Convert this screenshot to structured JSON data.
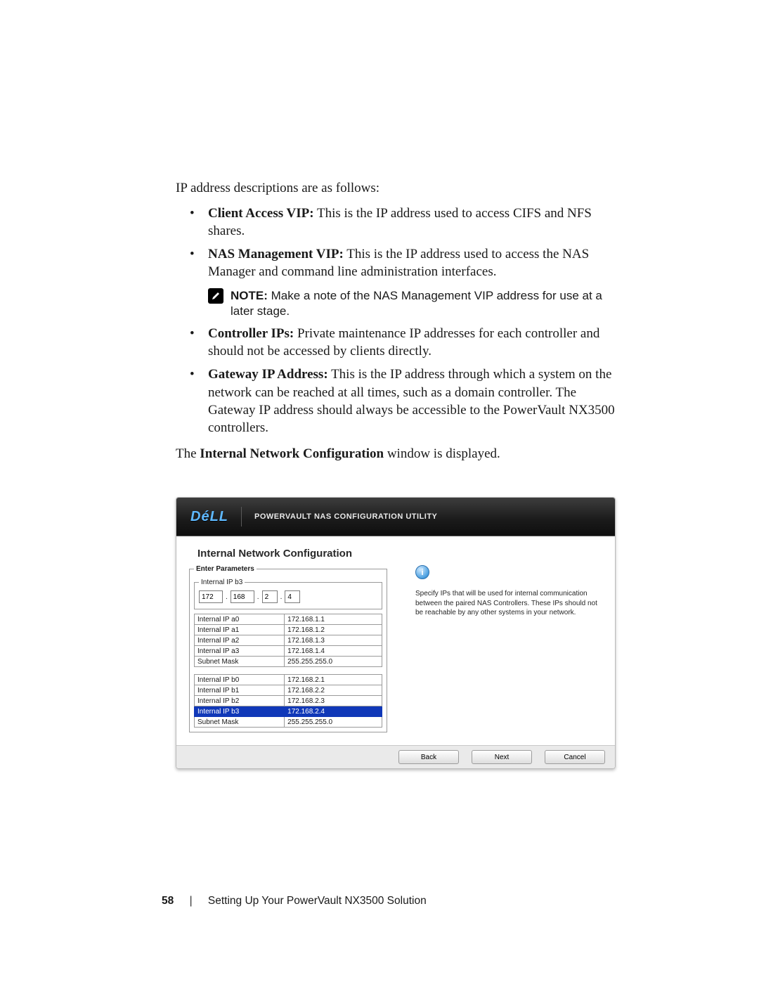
{
  "intro": "IP address descriptions are as follows:",
  "bullets_top": [
    {
      "bold": "Client Access VIP:",
      "text": " This is the IP address used to access CIFS and NFS shares."
    },
    {
      "bold": "NAS Management VIP:",
      "text": " This is the IP address used to access the NAS Manager and command line administration interfaces."
    }
  ],
  "note": {
    "bold": "NOTE:",
    "text": " Make a note of the NAS Management VIP address for use at a later stage."
  },
  "bullets_bottom": [
    {
      "bold": "Controller IPs:",
      "text": " Private maintenance IP addresses for each controller and should not be accessed by clients directly."
    },
    {
      "bold": "Gateway IP Address:",
      "text": " This is the IP address through which a system on the network can be reached at all times, such as a domain controller. The Gateway IP address should always be accessible to the PowerVault NX3500 controllers."
    }
  ],
  "displayed_prefix": "The ",
  "displayed_bold": "Internal Network Configuration",
  "displayed_suffix": " window is displayed.",
  "util": {
    "logo": "DéLL",
    "title": "POWERVAULT NAS CONFIGURATION UTILITY",
    "section": "Internal Network Configuration",
    "legend_enter": "Enter Parameters",
    "legend_b3": "Internal IP b3",
    "octets": [
      "172",
      "168",
      "2",
      "4"
    ],
    "table_a": [
      [
        "Internal IP a0",
        "172.168.1.1"
      ],
      [
        "Internal IP a1",
        "172.168.1.2"
      ],
      [
        "Internal IP a2",
        "172.168.1.3"
      ],
      [
        "Internal IP a3",
        "172.168.1.4"
      ],
      [
        "Subnet Mask",
        "255.255.255.0"
      ]
    ],
    "table_b": [
      [
        "Internal IP b0",
        "172.168.2.1"
      ],
      [
        "Internal IP b1",
        "172.168.2.2"
      ],
      [
        "Internal IP b2",
        "172.168.2.3"
      ],
      [
        "Internal IP b3",
        "172.168.2.4"
      ],
      [
        "Subnet Mask",
        "255.255.255.0"
      ]
    ],
    "highlight_row_b": 3,
    "info_letter": "i",
    "info_text": "Specify IPs that will be used for internal communication between the paired NAS Controllers. These IPs should not be reachable by any other systems in your network.",
    "btn_back": "Back",
    "btn_next": "Next",
    "btn_cancel": "Cancel"
  },
  "footer": {
    "page": "58",
    "sep": "|",
    "title": "Setting Up Your PowerVault NX3500 Solution"
  }
}
